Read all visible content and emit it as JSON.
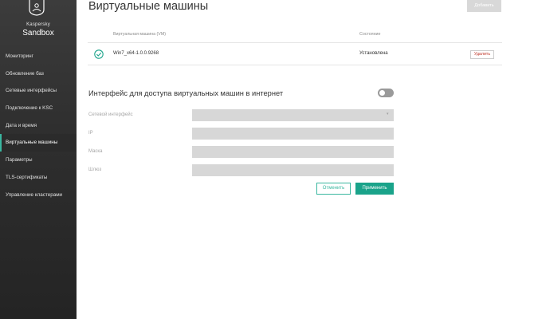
{
  "brand": {
    "line1": "Kaspersky",
    "line2": "Sandbox"
  },
  "sidebar": {
    "items": [
      {
        "label": "Мониторинг"
      },
      {
        "label": "Обновление баз"
      },
      {
        "label": "Сетевые интерфейсы"
      },
      {
        "label": "Подключение к KSC"
      },
      {
        "label": "Дата и время"
      },
      {
        "label": "Виртуальные машины",
        "active": true
      },
      {
        "label": "Параметры"
      },
      {
        "label": "TLS-сертификаты"
      },
      {
        "label": "Управление кластерами"
      }
    ]
  },
  "page": {
    "title": "Виртуальные машины",
    "add_label": "Добавить"
  },
  "vm_table": {
    "headers": {
      "name": "Виртуальная машина (VM)",
      "status": "Состояние"
    },
    "rows": [
      {
        "name": "Win7_x64-1.0.0.9268",
        "status": "Установлена",
        "action": "Удалить",
        "status_icon": "check-circle-icon"
      }
    ]
  },
  "internet": {
    "title": "Интерфейс для доступа виртуальных машин в интернет",
    "enabled": false,
    "fields": {
      "iface_label": "Сетевой интерфейс",
      "ip_label": "IP",
      "mask_label": "Маска",
      "gateway_label": "Шлюз"
    },
    "cancel_label": "Отменить",
    "apply_label": "Применить"
  },
  "colors": {
    "accent": "#1aa38a",
    "sidebar": "#2f2f2f",
    "danger": "#c0392b"
  }
}
